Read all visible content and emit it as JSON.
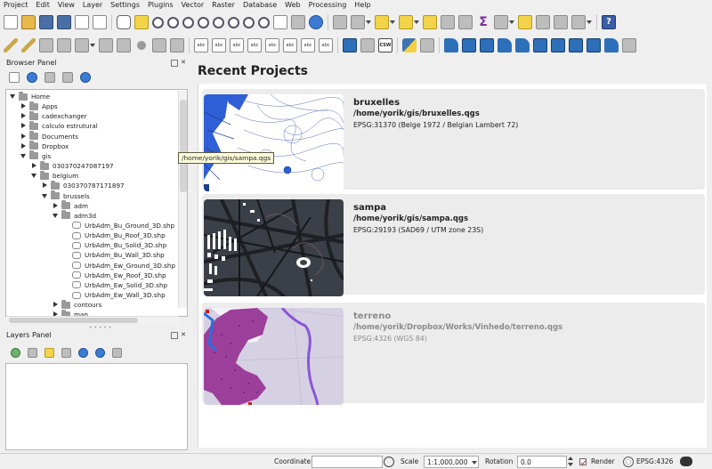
{
  "menu": [
    "Project",
    "Edit",
    "View",
    "Layer",
    "Settings",
    "Plugins",
    "Vector",
    "Raster",
    "Database",
    "Web",
    "Processing",
    "Help"
  ],
  "browser_panel": {
    "title": "Browser Panel",
    "tooltip": "/home/yorik/gis/sampa.qgs",
    "tree": [
      {
        "label": "Home",
        "depth": 0,
        "expanded": true,
        "type": "folder"
      },
      {
        "label": "Apps",
        "depth": 1,
        "expanded": false,
        "type": "folder"
      },
      {
        "label": "cadexchanger",
        "depth": 1,
        "expanded": false,
        "type": "folder"
      },
      {
        "label": "calculo estrutural",
        "depth": 1,
        "expanded": false,
        "type": "folder"
      },
      {
        "label": "Documents",
        "depth": 1,
        "expanded": false,
        "type": "folder"
      },
      {
        "label": "Dropbox",
        "depth": 1,
        "expanded": false,
        "type": "folder"
      },
      {
        "label": "gis",
        "depth": 1,
        "expanded": true,
        "type": "folder"
      },
      {
        "label": "030370247087197",
        "depth": 2,
        "expanded": false,
        "type": "folder"
      },
      {
        "label": "belgium",
        "depth": 2,
        "expanded": true,
        "type": "folder"
      },
      {
        "label": "030370787171897",
        "depth": 3,
        "expanded": false,
        "type": "folder"
      },
      {
        "label": "brussels",
        "depth": 3,
        "expanded": true,
        "type": "folder"
      },
      {
        "label": "adm",
        "depth": 4,
        "expanded": false,
        "type": "folder"
      },
      {
        "label": "adm3d",
        "depth": 4,
        "expanded": true,
        "type": "folder"
      },
      {
        "label": "UrbAdm_Bu_Ground_3D.shp",
        "depth": 5,
        "type": "file"
      },
      {
        "label": "UrbAdm_Bu_Roof_3D.shp",
        "depth": 5,
        "type": "file"
      },
      {
        "label": "UrbAdm_Bu_Solid_3D.shp",
        "depth": 5,
        "type": "file"
      },
      {
        "label": "UrbAdm_Bu_Wall_3D.shp",
        "depth": 5,
        "type": "file"
      },
      {
        "label": "UrbAdm_Ew_Ground_3D.shp",
        "depth": 5,
        "type": "file"
      },
      {
        "label": "UrbAdm_Ew_Roof_3D.shp",
        "depth": 5,
        "type": "file"
      },
      {
        "label": "UrbAdm_Ew_Solid_3D.shp",
        "depth": 5,
        "type": "file"
      },
      {
        "label": "UrbAdm_Ew_Wall_3D.shp",
        "depth": 5,
        "type": "file"
      },
      {
        "label": "contours",
        "depth": 4,
        "expanded": false,
        "type": "folder"
      },
      {
        "label": "map",
        "depth": 4,
        "expanded": false,
        "type": "folder"
      }
    ]
  },
  "layers_panel": {
    "title": "Layers Panel"
  },
  "recent": {
    "title": "Recent Projects",
    "projects": [
      {
        "name": "bruxelles",
        "path": "/home/yorik/gis/bruxelles.qgs",
        "crs": "EPSG:31370 (Belge 1972 / Belgian Lambert 72)",
        "available": true
      },
      {
        "name": "sampa",
        "path": "/home/yorik/gis/sampa.qgs",
        "crs": "EPSG:29193 (SAD69 / UTM zone 23S)",
        "available": true
      },
      {
        "name": "terreno",
        "path": "/home/yorik/Dropbox/Works/Vinhedo/terreno.qgs",
        "crs": "EPSG:4326 (WGS 84)",
        "available": false
      }
    ]
  },
  "status": {
    "coordinate_label": "Coordinate",
    "coordinate_value": "",
    "scale_label": "Scale",
    "scale_value": "1:1,000,000",
    "rotation_label": "Rotation",
    "rotation_value": "0.0",
    "render_label": "Render",
    "crs_value": "EPSG:4326"
  }
}
